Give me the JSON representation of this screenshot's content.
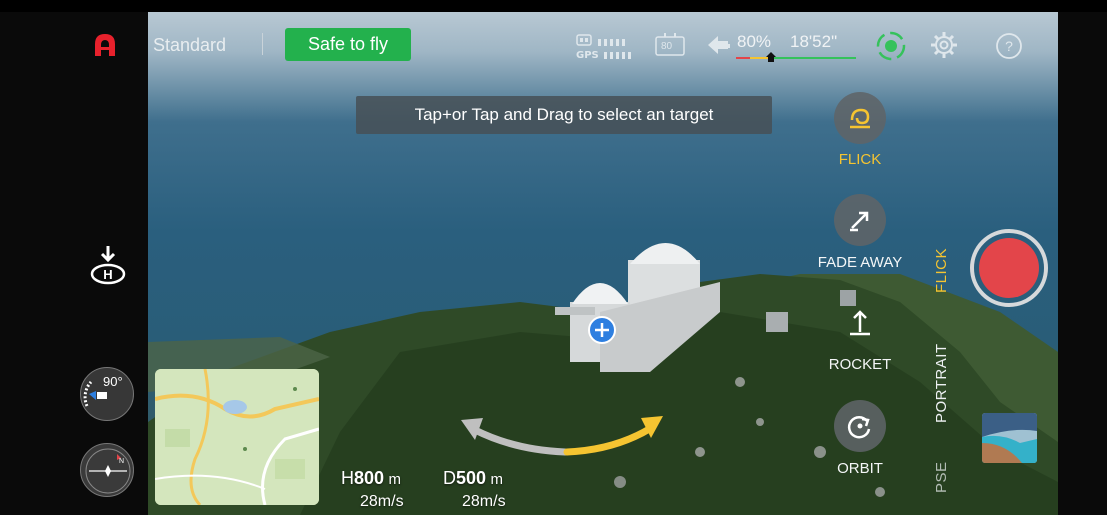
{
  "topbar": {
    "mode_label": "Standard",
    "safety_status": "Safe to fly",
    "gps_label": "GPS",
    "battery_icon_value": "80",
    "battery_percent": "80%",
    "flight_time": "18'52\"",
    "icons": [
      "logo-icon",
      "remote-signal-icon",
      "battery-icon",
      "return-home-icon",
      "obstacle-avoidance-icon",
      "settings-icon",
      "help-icon"
    ]
  },
  "hint": {
    "text": "Tap+or Tap and Drag to select an target"
  },
  "quickshot": {
    "options": [
      {
        "label": "FLICK",
        "active": true,
        "icon": "flick-icon"
      },
      {
        "label": "FADE AWAY",
        "active": false,
        "icon": "fade-away-icon"
      },
      {
        "label": "ROCKET",
        "active": false,
        "icon": "rocket-icon"
      },
      {
        "label": "ORBIT",
        "active": false,
        "icon": "orbit-icon"
      }
    ]
  },
  "mode_tabs": [
    {
      "label": "FLICK",
      "active": true
    },
    {
      "label": "PORTRAIT",
      "active": false
    },
    {
      "label": "PSE",
      "active": false
    }
  ],
  "left_panel": {
    "heading_value": "90°",
    "icons": [
      "takeoff-landing-icon",
      "gimbal-heading-icon",
      "compass-icon"
    ]
  },
  "telemetry": {
    "height_key": "H",
    "height_value": "800",
    "height_unit": "m",
    "height_speed": "28m/s",
    "distance_key": "D",
    "distance_value": "500",
    "distance_unit": "m",
    "distance_speed": "28m/s"
  },
  "colors": {
    "accent_yellow": "#f5c431",
    "safe_green": "#23b14d",
    "shutter_red": "#e3454a",
    "target_blue": "#2e7fe0"
  }
}
